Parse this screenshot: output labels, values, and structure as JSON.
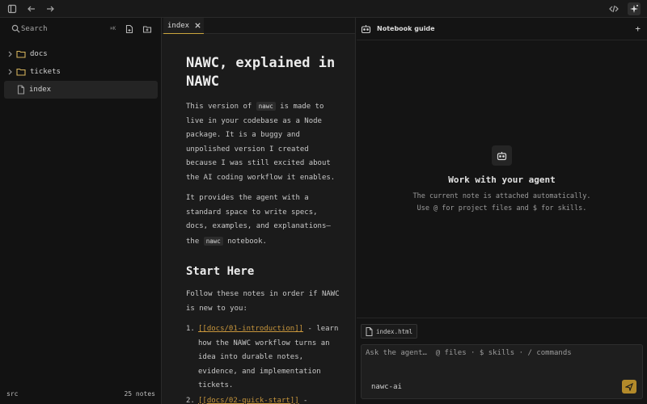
{
  "topbar": {
    "buttons": [
      "sidebar-toggle",
      "back",
      "forward",
      "code-view",
      "sparkle-agent"
    ]
  },
  "sidebar": {
    "search_placeholder": "Search",
    "search_shortcut": "⌘K",
    "items": [
      {
        "type": "folder",
        "label": "docs"
      },
      {
        "type": "folder",
        "label": "tickets"
      },
      {
        "type": "file",
        "label": "index",
        "selected": true
      }
    ],
    "footer": {
      "left": "src",
      "right": "25 notes"
    }
  },
  "editor": {
    "tab_label": "index",
    "title": "NAWC, explained in NAWC",
    "p1": {
      "before": "This version of ",
      "code": "nawc",
      "after": " is made to live in your codebase as a Node package. It is a buggy and unpolished version I created because I was still excited about the AI coding workflow it enables."
    },
    "p2": {
      "before": "It provides the agent with a standard space to write specs, docs, examples, and explanations—the ",
      "code": "nawc",
      "after": " notebook."
    },
    "h2": "Start Here",
    "p3": "Follow these notes in order if NAWC is new to you:",
    "list": [
      {
        "num": "1.",
        "link": "[[docs/01-introduction]]",
        "text": " - learn how the NAWC workflow turns an idea into durable notes, evidence, and implementation tickets."
      },
      {
        "num": "2.",
        "link": "[[docs/02-quick-start]]",
        "text": " -"
      }
    ]
  },
  "guide": {
    "title": "Notebook guide",
    "plus": "+",
    "empty_title": "Work with your agent",
    "empty_sub1": "The current note is attached automatically.",
    "empty_sub2": "Use @ for project files and $ for skills.",
    "attachment": "index.html",
    "composer_placeholder": "Ask the agent…  @ files · $ skills · / commands",
    "model": "nawc-ai"
  },
  "colors": {
    "accent": "#b38a2a",
    "link": "#c8963c",
    "folder": "#d4b25c"
  }
}
